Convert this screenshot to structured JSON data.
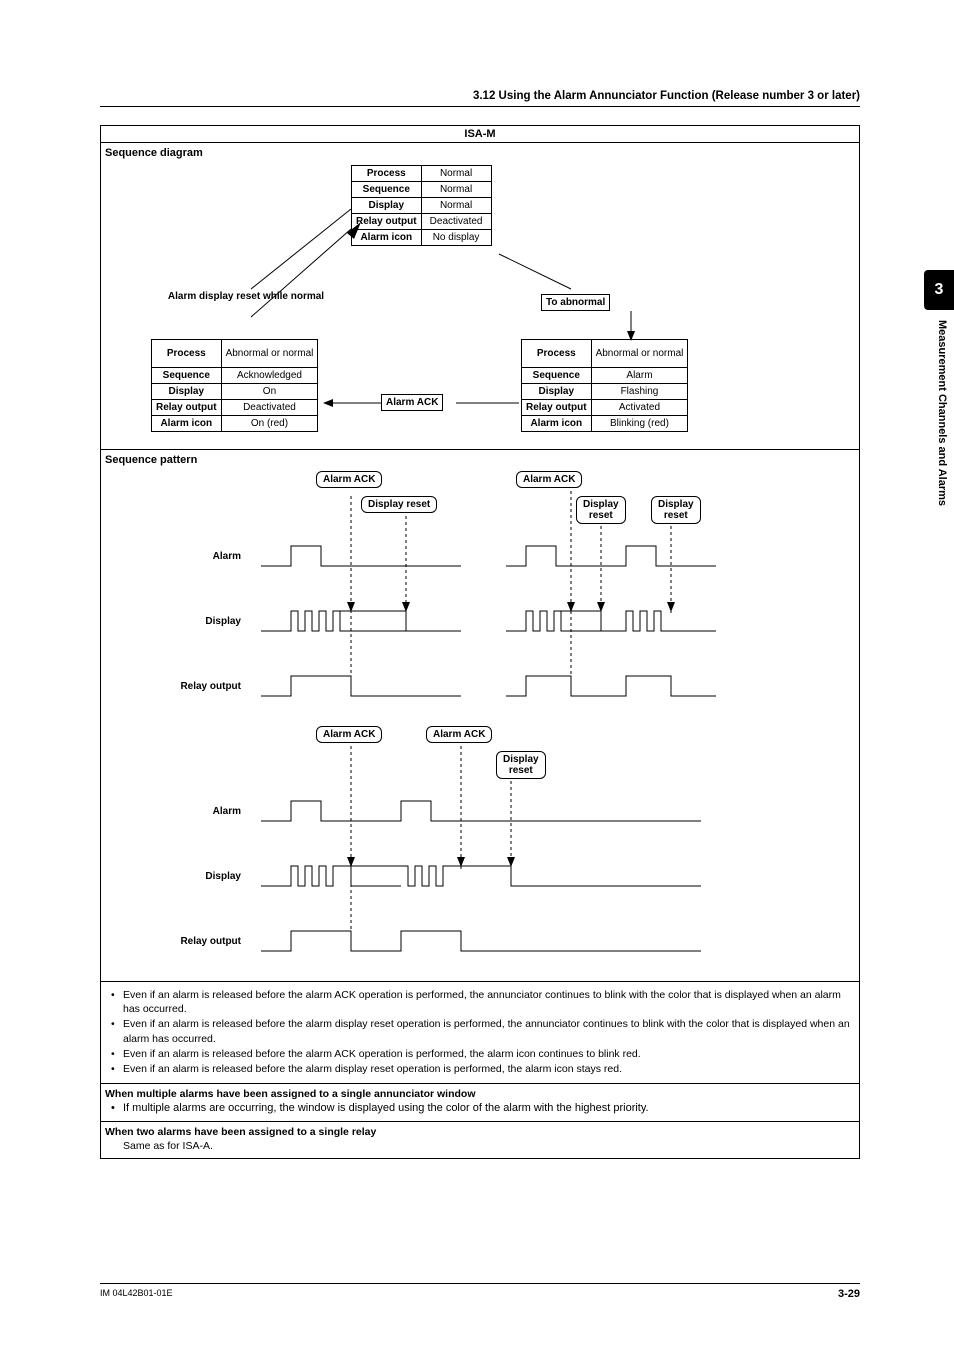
{
  "header": {
    "section_title": "3.12  Using the Alarm Annunciator Function (Release number 3 or later)"
  },
  "side": {
    "chapter_num": "3",
    "chapter_title": "Measurement Channels and Alarms"
  },
  "main_title": "ISA-M",
  "seq_diagram_label": "Sequence diagram",
  "normal_state": {
    "rows": [
      [
        "Process",
        "Normal"
      ],
      [
        "Sequence",
        "Normal"
      ],
      [
        "Display",
        "Normal"
      ],
      [
        "Relay output",
        "Deactivated"
      ],
      [
        "Alarm icon",
        "No display"
      ]
    ]
  },
  "reset_note": "Alarm display reset while normal",
  "to_abnormal": "To abnormal",
  "left_state": {
    "rows": [
      [
        "Process",
        "Abnormal or normal"
      ],
      [
        "Sequence",
        "Acknowledged"
      ],
      [
        "Display",
        "On"
      ],
      [
        "Relay output",
        "Deactivated"
      ],
      [
        "Alarm icon",
        "On (red)"
      ]
    ]
  },
  "right_state": {
    "rows": [
      [
        "Process",
        "Abnormal or normal"
      ],
      [
        "Sequence",
        "Alarm"
      ],
      [
        "Display",
        "Flashing"
      ],
      [
        "Relay output",
        "Activated"
      ],
      [
        "Alarm icon",
        "Blinking (red)"
      ]
    ]
  },
  "alarm_ack": "Alarm ACK",
  "seq_pattern_label": "Sequence pattern",
  "pattern_labels": {
    "alarm_ack": "Alarm ACK",
    "display_reset": "Display reset",
    "display_reset_2line": "Display\nreset",
    "alarm": "Alarm",
    "display": "Display",
    "relay_output": "Relay output"
  },
  "notes": [
    "Even if an alarm is released before the alarm ACK operation is performed, the annunciator continues to blink with the color that is displayed when an alarm has occurred.",
    "Even if an alarm is released before the alarm display reset operation is performed, the annunciator continues to blink with the color that is displayed when an alarm has occurred.",
    "Even if an alarm is released before the alarm ACK operation is performed, the alarm icon continues to blink red.",
    "Even if an alarm is released before the alarm display reset operation is performed, the alarm icon stays red."
  ],
  "multi_alarm_head": "When multiple alarms have been assigned to a single annunciator window",
  "multi_alarm_note": "If multiple alarms are occurring, the window is displayed using the color of the alarm with the highest priority.",
  "two_alarm_head": "When two alarms have been assigned to a single relay",
  "two_alarm_note": "Same as for ISA-A.",
  "footer": {
    "doc_id": "IM 04L42B01-01E",
    "page_num": "3-29"
  }
}
